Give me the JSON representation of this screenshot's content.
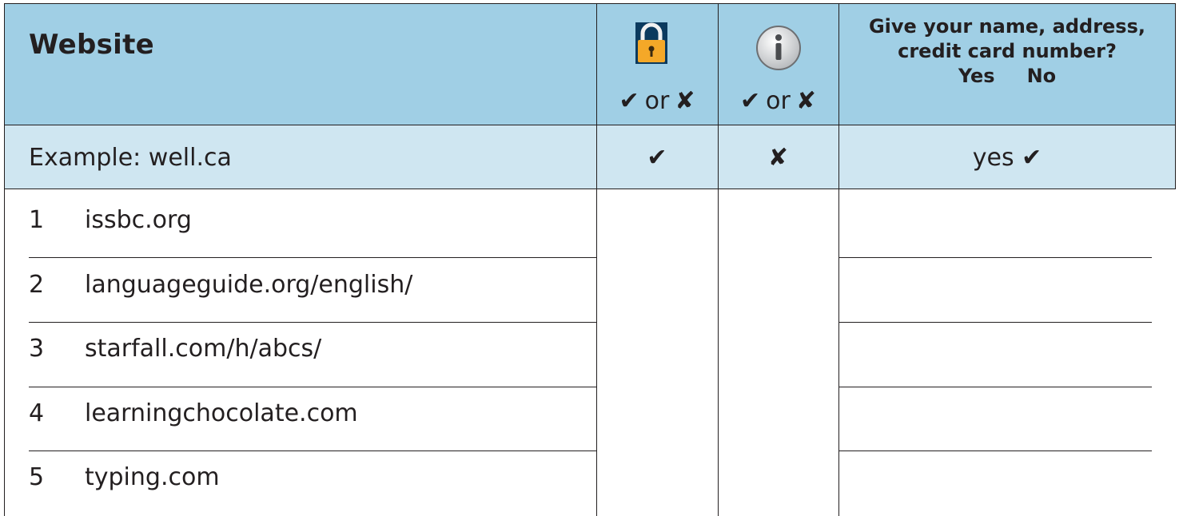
{
  "header": {
    "website": "Website",
    "mark_or": "or",
    "give_line1": "Give your name, address,",
    "give_line2": "credit card number?",
    "yes": "Yes",
    "no": "No",
    "check_symbol": "✔",
    "cross_symbol": "✘",
    "lock_icon": "padlock-icon",
    "info_icon": "info-icon",
    "colors": {
      "header_bg": "#a0cfe5",
      "example_bg": "#cfe6f1",
      "lock": "#f4a828"
    }
  },
  "example": {
    "label": "Example: well.ca",
    "lock_value": "✔",
    "info_value": "✘",
    "give_value": "yes ✔"
  },
  "rows": [
    {
      "num": "1",
      "site": "issbc.org"
    },
    {
      "num": "2",
      "site": "languageguide.org/english/"
    },
    {
      "num": "3",
      "site": "starfall.com/h/abcs/"
    },
    {
      "num": "4",
      "site": "learningchocolate.com"
    },
    {
      "num": "5",
      "site": "typing.com"
    }
  ]
}
